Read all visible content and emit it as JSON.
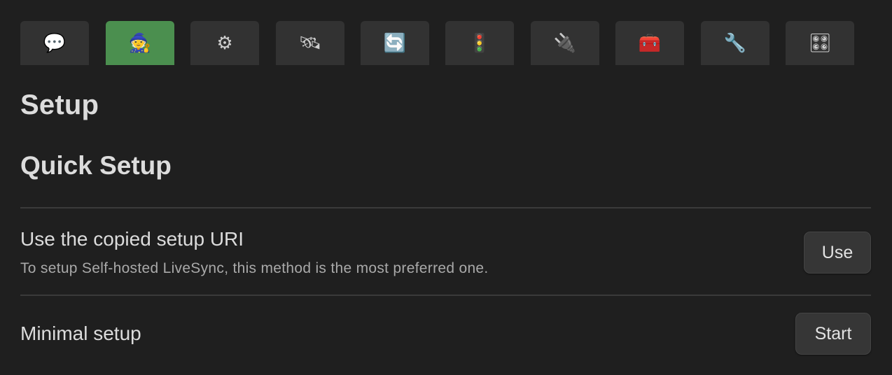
{
  "tabs": [
    {
      "icon": "speech-balloon-icon",
      "glyph": "💬",
      "active": false
    },
    {
      "icon": "wizard-icon",
      "glyph": "🧙",
      "active": true
    },
    {
      "icon": "gear-icon",
      "glyph": "⚙",
      "active": false
    },
    {
      "icon": "satellite-icon",
      "glyph": "🛰",
      "active": false
    },
    {
      "icon": "sync-arrows-icon",
      "glyph": "🔄",
      "active": false
    },
    {
      "icon": "traffic-light-icon",
      "glyph": "🚦",
      "active": false
    },
    {
      "icon": "plug-icon",
      "glyph": "🔌",
      "active": false
    },
    {
      "icon": "toolbox-icon",
      "glyph": "🧰",
      "active": false
    },
    {
      "icon": "wrench-icon",
      "glyph": "🔧",
      "active": false
    },
    {
      "icon": "control-knobs-icon",
      "glyph": "🎛",
      "active": false
    }
  ],
  "colors": {
    "background": "#1f1f1f",
    "tab_background": "#323232",
    "tab_active": "#4b8f4f",
    "divider": "#3a3a3a"
  },
  "page": {
    "title": "Setup",
    "section_title": "Quick Setup"
  },
  "settings": [
    {
      "name": "Use the copied setup URI",
      "description": "To setup Self-hosted LiveSync, this method is the most preferred one.",
      "button": "Use"
    },
    {
      "name": "Minimal setup",
      "description": "",
      "button": "Start"
    }
  ]
}
